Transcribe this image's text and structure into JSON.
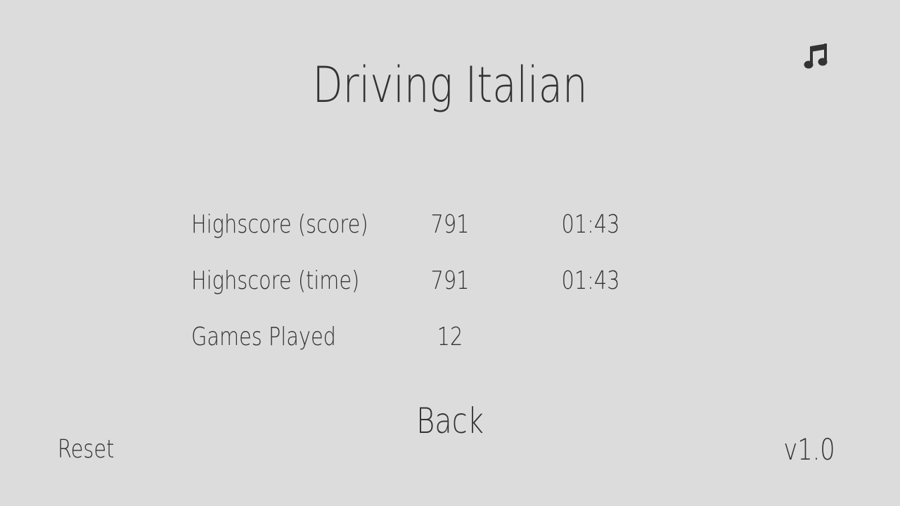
{
  "game": {
    "title": "Driving Italian"
  },
  "icons": {
    "music": "music-note-icon"
  },
  "stats": {
    "rows": [
      {
        "label": "Highscore (score)",
        "value": "791",
        "time": "01:43"
      },
      {
        "label": "Highscore (time)",
        "value": "791",
        "time": "01:43"
      },
      {
        "label": "Games Played",
        "value": "12",
        "time": ""
      }
    ]
  },
  "buttons": {
    "back": "Back",
    "reset": "Reset"
  },
  "version": "v1.0",
  "colors": {
    "background": "#dcdcdc",
    "text": "#333333"
  }
}
